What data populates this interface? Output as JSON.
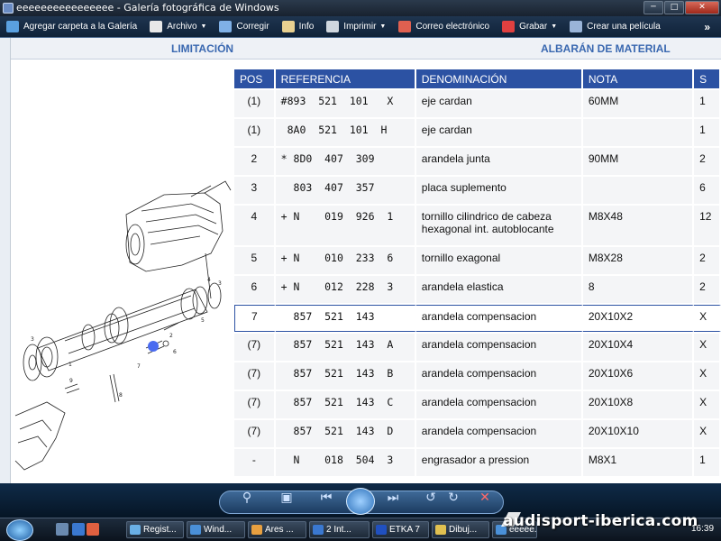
{
  "window": {
    "title": "eeeeeeeeeeeeeeee - Galería fotográfica de Windows"
  },
  "toolbar": {
    "items": [
      {
        "label": "Agregar carpeta a la Galería",
        "icon": "add-folder-icon",
        "color": "#5aa0e0",
        "dropdown": false
      },
      {
        "label": "Archivo",
        "icon": "file-icon",
        "color": "#e8e8e8",
        "dropdown": true
      },
      {
        "label": "Corregir",
        "icon": "fix-icon",
        "color": "#7fb0e6",
        "dropdown": false
      },
      {
        "label": "Info",
        "icon": "info-icon",
        "color": "#e8d090",
        "dropdown": false
      },
      {
        "label": "Imprimir",
        "icon": "printer-icon",
        "color": "#cfd6de",
        "dropdown": true
      },
      {
        "label": "Correo electrónico",
        "icon": "email-icon",
        "color": "#e06050",
        "dropdown": false
      },
      {
        "label": "Grabar",
        "icon": "burn-disc-icon",
        "color": "#e04040",
        "dropdown": true
      },
      {
        "label": "Crear una película",
        "icon": "movie-icon",
        "color": "#9ab4d8",
        "dropdown": false
      }
    ],
    "more": "»"
  },
  "header": {
    "left": "LIMITACIÓN",
    "right": "ALBARÁN DE MATERIAL"
  },
  "table": {
    "columns": [
      "POS",
      "REFERENCIA",
      "DENOMINACIÓN",
      "NOTA",
      "S"
    ],
    "rows": [
      {
        "pos": "(1)",
        "ref": "#893  521  101   X",
        "den": "eje cardan",
        "nota": "60MM",
        "st": "1",
        "h": "h32"
      },
      {
        "pos": "(1)",
        "ref": " 8A0  521  101  H",
        "den": "eje cardan",
        "nota": "",
        "st": "1",
        "h": "h32"
      },
      {
        "pos": "2",
        "ref": "* 8D0  407  309",
        "den": "arandela junta",
        "nota": "90MM",
        "st": "2",
        "h": "h32"
      },
      {
        "pos": "3",
        "ref": "  803  407  357",
        "den": "placa suplemento",
        "nota": "",
        "st": "6",
        "h": "h32"
      },
      {
        "pos": "4",
        "ref": "+ N    019  926  1",
        "den": "tornillo cilindrico de cabeza hexagonal int. autoblocante",
        "nota": "M8X48",
        "st": "12",
        "h": "h44"
      },
      {
        "pos": "5",
        "ref": "+ N    010  233  6",
        "den": "tornillo exagonal",
        "nota": "M8X28",
        "st": "2",
        "h": "h32"
      },
      {
        "pos": "6",
        "ref": "+ N    012  228  3",
        "den": "arandela elastica",
        "nota": "8",
        "st": "2",
        "h": "h32"
      },
      {
        "pos": "7",
        "ref": "  857  521  143",
        "den": "arandela compensacion",
        "nota": "20X10X2",
        "st": "X",
        "h": "h32",
        "selected": true
      },
      {
        "pos": "(7)",
        "ref": "  857  521  143  A",
        "den": "arandela compensacion",
        "nota": "20X10X4",
        "st": "X",
        "h": "h32"
      },
      {
        "pos": "(7)",
        "ref": "  857  521  143  B",
        "den": "arandela compensacion",
        "nota": "20X10X6",
        "st": "X",
        "h": "h32"
      },
      {
        "pos": "(7)",
        "ref": "  857  521  143  C",
        "den": "arandela compensacion",
        "nota": "20X10X8",
        "st": "X",
        "h": "h32"
      },
      {
        "pos": "(7)",
        "ref": "  857  521  143  D",
        "den": "arandela compensacion",
        "nota": "20X10X10",
        "st": "X",
        "h": "h32"
      },
      {
        "pos": "-",
        "ref": "  N    018  504  3",
        "den": "engrasador a pression",
        "nota": "M8X1",
        "st": "1",
        "h": "h32"
      }
    ]
  },
  "taskbar": {
    "tasks": [
      {
        "label": "Regist...",
        "color": "#6ab0e6"
      },
      {
        "label": "Wind...",
        "color": "#4a90d8"
      },
      {
        "label": "Ares ...",
        "color": "#e8a040"
      },
      {
        "label": "2 Int...",
        "color": "#3a78d0"
      },
      {
        "label": "ETKA 7",
        "color": "#2050c0"
      },
      {
        "label": "Dibuj...",
        "color": "#e0c050"
      },
      {
        "label": "eeeee...",
        "color": "#4a90d8"
      }
    ],
    "clock": "16:39"
  },
  "watermark": "audisport-iberica.com"
}
